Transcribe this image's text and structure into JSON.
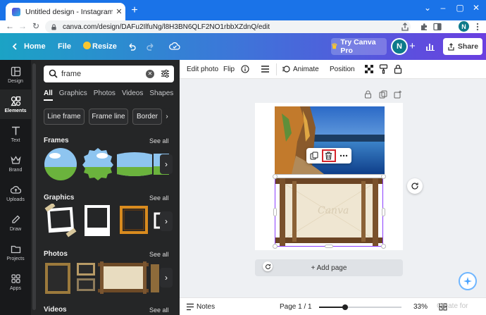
{
  "browser": {
    "tab_title": "Untitled design - Instagram Post",
    "close_glyph": "✕",
    "new_tab_glyph": "+",
    "window_controls": [
      "⌄",
      "–",
      "▢",
      "✕"
    ],
    "url": "canva.com/design/DAFu2IlfuNg/l8H3BN6QLF2NO1rbbXZdnQ/edit",
    "profile_initial": "N",
    "nav_glyphs": [
      "←",
      "→",
      "↻"
    ]
  },
  "header": {
    "home": "Home",
    "file": "File",
    "resize": "Resize",
    "try_pro": "Try Canva Pro",
    "avatar_initial": "N",
    "share": "Share",
    "colors": {
      "gradient_start": "#1ba3c5",
      "gradient_end": "#6a3fe0"
    }
  },
  "rail": {
    "items": [
      {
        "label": "Design",
        "icon": "layout-icon"
      },
      {
        "label": "Elements",
        "icon": "shapes-icon",
        "active": true
      },
      {
        "label": "Text",
        "icon": "text-icon"
      },
      {
        "label": "Brand",
        "icon": "brand-crown-icon"
      },
      {
        "label": "Uploads",
        "icon": "cloud-upload-icon"
      },
      {
        "label": "Draw",
        "icon": "pen-icon"
      },
      {
        "label": "Projects",
        "icon": "folder-icon"
      },
      {
        "label": "Apps",
        "icon": "apps-grid-icon"
      }
    ]
  },
  "panel": {
    "search_value": "frame",
    "tabs": [
      "All",
      "Graphics",
      "Photos",
      "Videos",
      "Shapes"
    ],
    "chips": [
      "Line frame",
      "Frame line",
      "Border"
    ],
    "sections": {
      "frames": "Frames",
      "graphics": "Graphics",
      "photos": "Photos",
      "videos": "Videos",
      "see_all": "See all"
    }
  },
  "toolbar": {
    "edit_photo": "Edit photo",
    "flip": "Flip",
    "animate": "Animate",
    "position": "Position"
  },
  "canvas": {
    "add_page": "+ Add page",
    "watermark_text": "Canva",
    "colors": {
      "selection": "#8b3dff",
      "delete_highlight": "#d4262c"
    }
  },
  "footer": {
    "notes": "Notes",
    "page_indicator": "Page 1 / 1",
    "zoom": "33%",
    "zoom_slider_fraction": 0.32
  },
  "watermark": "Create for"
}
